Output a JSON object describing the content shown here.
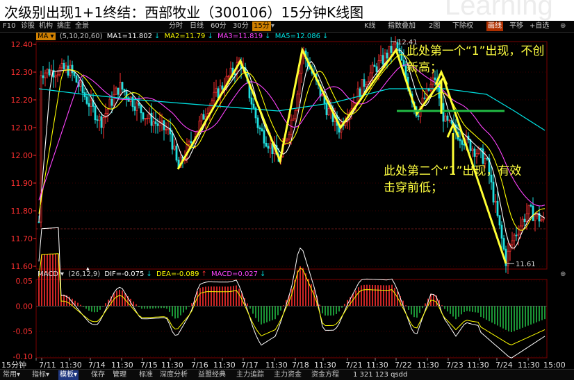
{
  "title": "次级别出现1+1终结：西部牧业（300106）15分钟K线图",
  "watermark": "Learning",
  "toolbar": {
    "left_items": [
      "F10",
      "诊股",
      "机构",
      "擒庄",
      "全景"
    ],
    "periods": [
      "分时",
      "日线",
      "60分",
      "30分",
      "15分"
    ],
    "selected_period": "15分",
    "right_items": [
      "K线",
      "指数叠加",
      "2图",
      "下除权",
      "画线",
      "平移",
      "+自选"
    ]
  },
  "ma_legend": {
    "label": "MA",
    "params": "(5,10,20,60)",
    "ma1": "MA1=11.802",
    "ma2": "MA2=11.79",
    "ma3": "MA3=11.819",
    "ma5": "MA5=12.086",
    "colors": {
      "ma1": "#ffffff",
      "ma2": "#ffff00",
      "ma3": "#ff44ff",
      "ma5": "#00e0e0"
    }
  },
  "macd_legend": {
    "label": "MACD",
    "params": "(26,12,9)",
    "dif": "DIF=-0.075",
    "dea": "DEA=-0.089",
    "macd": "MACD=0.027"
  },
  "price_axis": {
    "labels": [
      "12.40",
      "12.30",
      "12.20",
      "12.10",
      "12.00",
      "11.90",
      "11.80",
      "11.70",
      "11.60"
    ],
    "ylim": [
      11.6,
      12.4
    ]
  },
  "macd_axis": {
    "labels": [
      "0.05",
      "0.00",
      "-0.05",
      "-0.10"
    ],
    "ylim": [
      -0.1,
      0.05
    ]
  },
  "annotations": {
    "high_mark": "12.41",
    "low_mark": "11.61",
    "note1": "此处第一个“1”出现，不创新高；",
    "note2": "此处第二个“1”出现，有效击穿前低；"
  },
  "time_axis": [
    "15分钟",
    "7/11",
    "11:30",
    "7/14",
    "11:30",
    "7/15",
    "11:30",
    "7/16",
    "11:30",
    "7/17",
    "11:30",
    "7/18",
    "11:30",
    "7/21",
    "11:30",
    "7/22",
    "11:30",
    "7/23",
    "11:30",
    "7/24",
    "11:30",
    "15:00"
  ],
  "bottom_bar": {
    "items": [
      "常用",
      "指标",
      "模板",
      "保存",
      "管理",
      "标准",
      "深度分析",
      "益盟经典",
      "主力追踪",
      "主力资金",
      "资金方程"
    ],
    "selected": "模板",
    "status": "1 321 123 qsdd"
  },
  "colors": {
    "up": "#ff3030",
    "down": "#20e0e0",
    "zigzag": "#ffff33",
    "support_line": "#22bb44",
    "axis_text": "#ff3030",
    "grid": "#7a0000"
  },
  "chart_data": {
    "type": "candlestick",
    "unit": "15分钟",
    "x": [
      "7/11",
      "7/14",
      "7/15",
      "7/16",
      "7/17",
      "7/18",
      "7/21",
      "7/22",
      "7/23",
      "7/24"
    ],
    "ylim": [
      11.6,
      12.4
    ],
    "high": 12.41,
    "low": 11.61,
    "zigzag_prices": [
      11.95,
      12.34,
      11.98,
      12.38,
      12.1,
      12.38,
      12.15,
      12.41,
      12.15,
      12.28,
      11.61
    ],
    "support_level": 12.16,
    "ma_latest": {
      "MA1": 11.802,
      "MA2": 11.79,
      "MA3": 11.819,
      "MA5": 12.086
    },
    "macd_latest": {
      "DIF": -0.075,
      "DEA": -0.089,
      "MACD": 0.027
    },
    "macd_ylim": [
      -0.1,
      0.05
    ]
  }
}
